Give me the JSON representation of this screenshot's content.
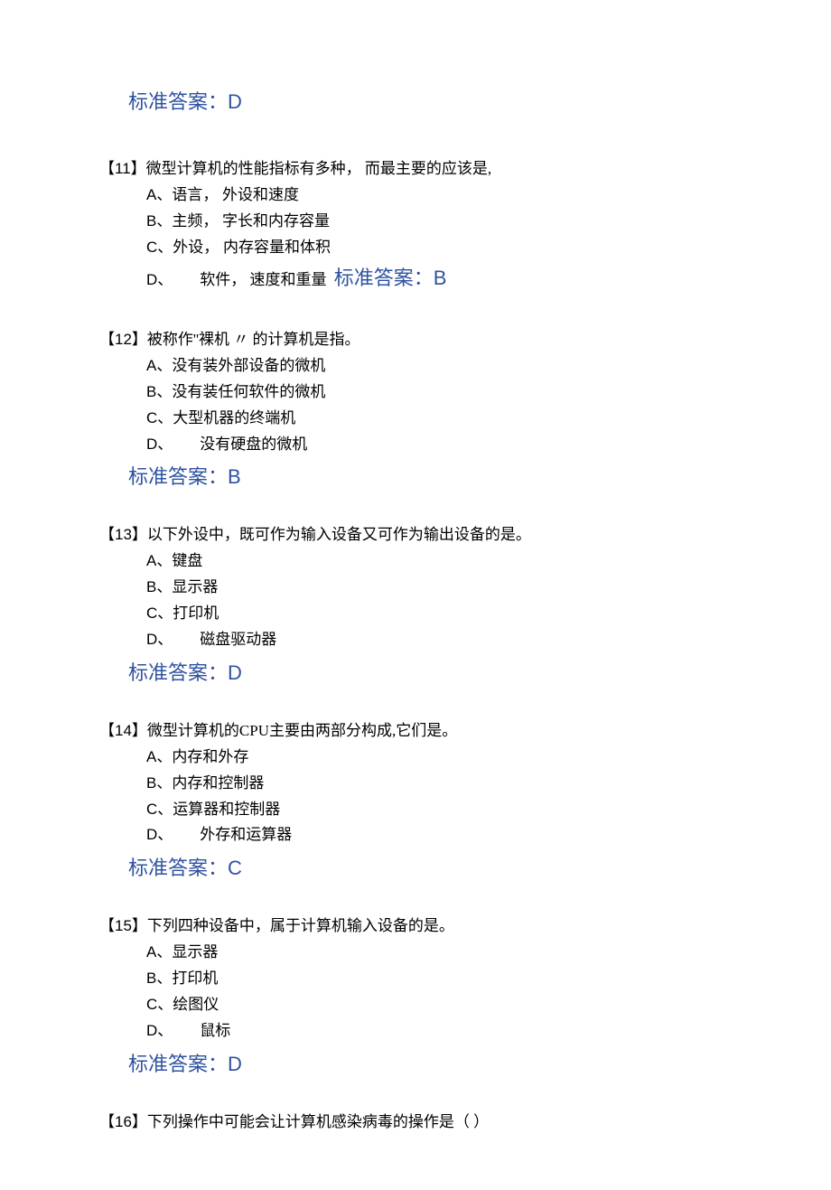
{
  "top_answer": {
    "label": "标准答案：",
    "letter": "D"
  },
  "answer_label": "标准答案：",
  "q11": {
    "num": "【11】",
    "text": "微型计算机的性能指标有多种， 而最主要的应该是,",
    "opts": {
      "a": "A、语言， 外设和速度",
      "b": "B、主频， 字长和内存容量",
      "c": "C、外设， 内存容量和体积",
      "d_lett": "D、",
      "d_text": "软件， 速度和重量"
    },
    "answer": "B"
  },
  "q12": {
    "num": "【12】",
    "text": "被称作''裸机 〃 的计算机是指。",
    "opts": {
      "a": "A、没有装外部设备的微机",
      "b": "B、没有装任何软件的微机",
      "c": "C、大型机器的终端机",
      "d_lett": "D、",
      "d_text": "没有硬盘的微机"
    },
    "answer": "B"
  },
  "q13": {
    "num": "【13】",
    "text": "以下外设中，既可作为输入设备又可作为输出设备的是。",
    "opts": {
      "a": "A、键盘",
      "b": "B、显示器",
      "c": "C、打印机",
      "d_lett": "D、",
      "d_text": "磁盘驱动器"
    },
    "answer": "D"
  },
  "q14": {
    "num": "【14】",
    "text": "微型计算机的CPU主要由两部分构成,它们是。",
    "opts": {
      "a": "A、内存和外存",
      "b": "B、内存和控制器",
      "c": "C、运算器和控制器",
      "d_lett": "D、",
      "d_text": "外存和运算器"
    },
    "answer": "C"
  },
  "q15": {
    "num": "【15】",
    "text": "下列四种设备中，属于计算机输入设备的是。",
    "opts": {
      "a": "A、显示器",
      "b": "B、打印机",
      "c": "C、绘图仪",
      "d_lett": "D、",
      "d_text": "鼠标"
    },
    "answer": "D"
  },
  "q16": {
    "num": "【16】",
    "text": "下列操作中可能会让计算机感染病毒的操作是（ ）"
  }
}
